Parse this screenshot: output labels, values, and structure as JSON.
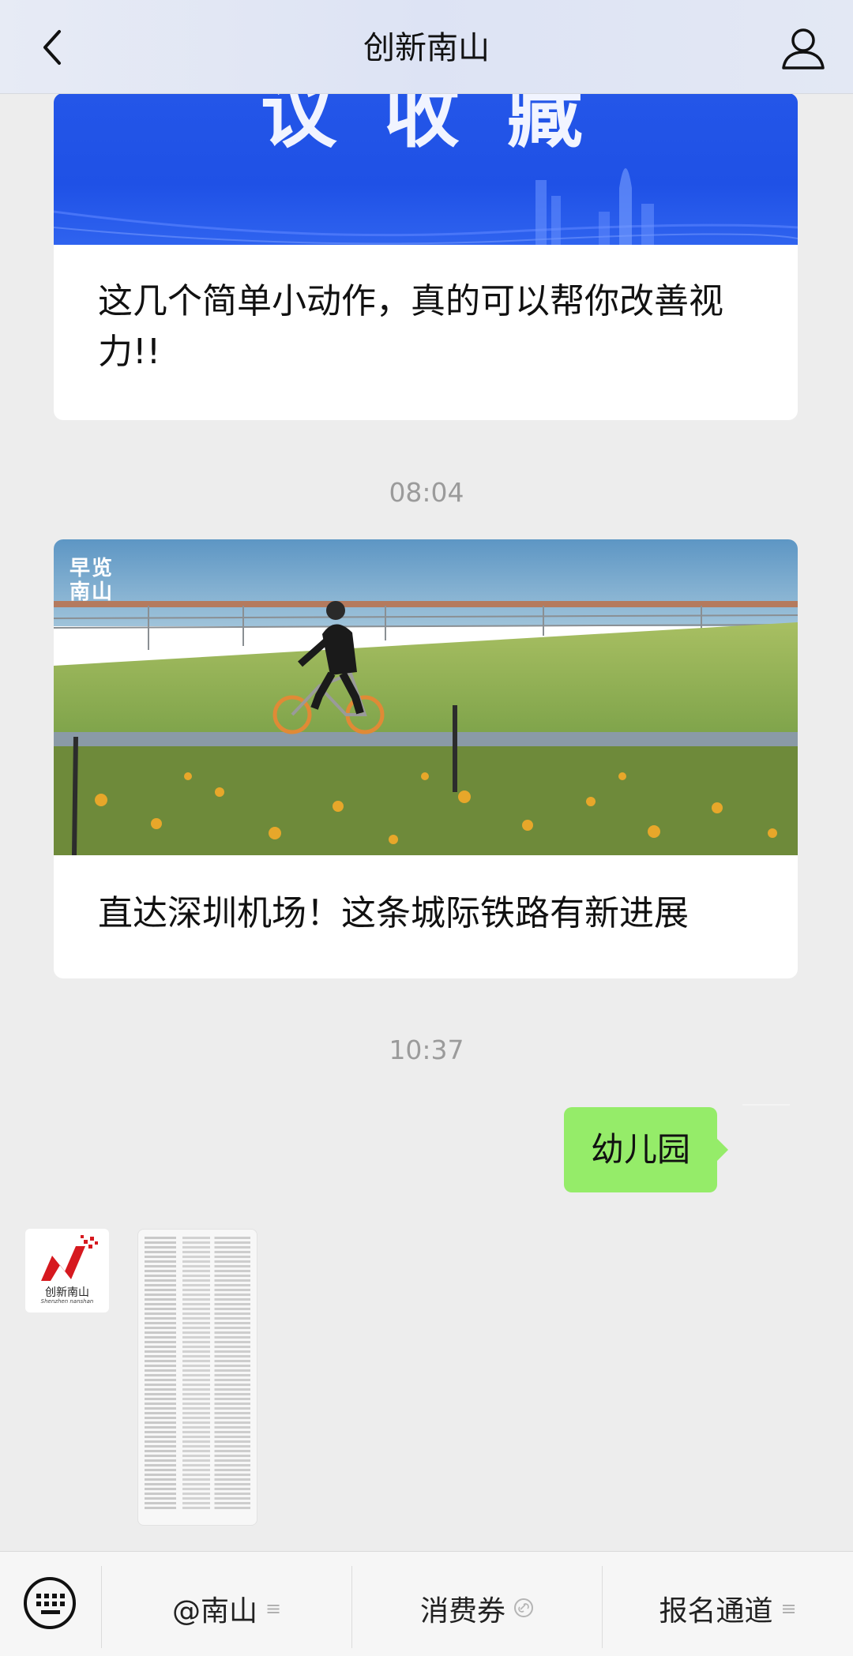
{
  "header": {
    "title": "创新南山",
    "back_icon": "chevron-left-icon",
    "profile_icon": "person-icon"
  },
  "messages": {
    "card1": {
      "banner_text": "议收藏",
      "title": "这几个简单小动作，真的可以帮你改善视力!!"
    },
    "time1": "08:04",
    "card2": {
      "watermark": "早览南山",
      "title": "直达深圳机场！这条城际铁路有新进展"
    },
    "time2": "10:37",
    "user_bubble": "幼儿园",
    "reply_avatar_logo": "创新南山",
    "reply_avatar_sub": "Shenzhen nanshan"
  },
  "menu": {
    "keyboard_icon": "keyboard-icon",
    "items": [
      {
        "label": "@南山",
        "icon": "menu-lines-icon"
      },
      {
        "label": "消费券",
        "icon": "link-icon"
      },
      {
        "label": "报名通道",
        "icon": "menu-lines-icon"
      }
    ]
  },
  "colors": {
    "bubble": "#95ec69",
    "banner_blue": "#2456e8",
    "background": "#ededed"
  }
}
